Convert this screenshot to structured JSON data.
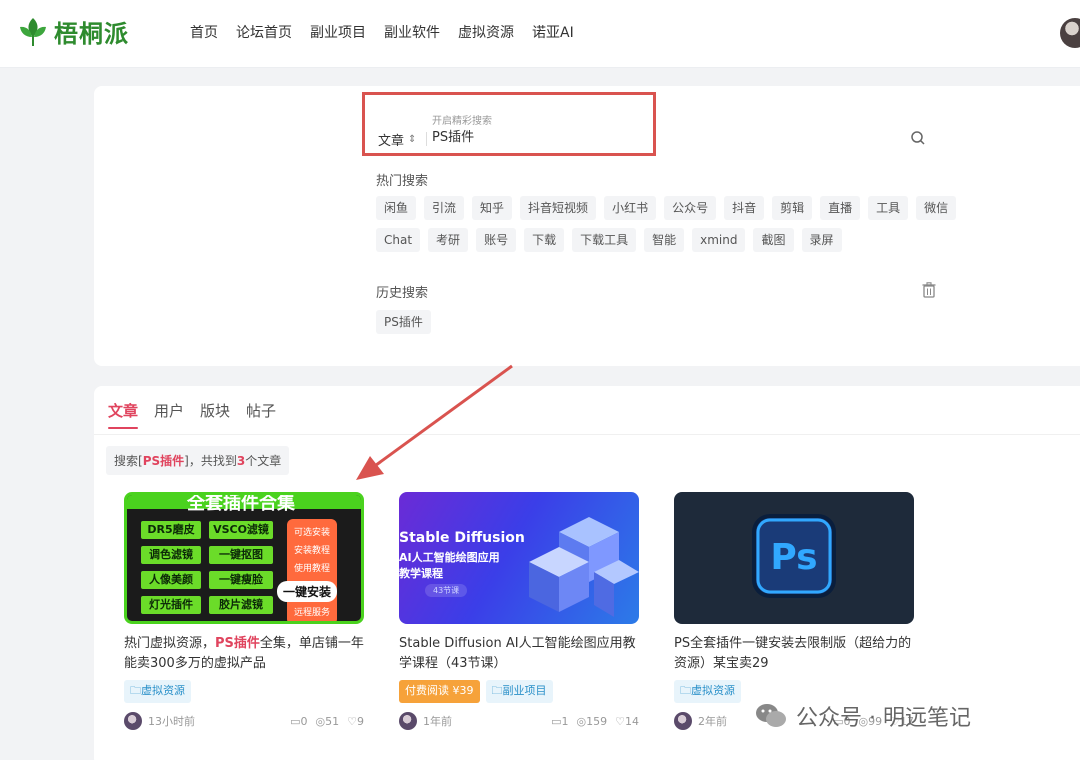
{
  "header": {
    "logo_text": "梧桐派",
    "nav": [
      "首页",
      "论坛首页",
      "副业项目",
      "副业软件",
      "虚拟资源",
      "诺亚AI"
    ]
  },
  "search": {
    "hint": "开启精彩搜索",
    "type": "文章",
    "value": "PS插件",
    "hot_label": "热门搜索",
    "hot_tags": [
      "闲鱼",
      "引流",
      "知乎",
      "抖音短视频",
      "小红书",
      "公众号",
      "抖音",
      "剪辑",
      "直播",
      "工具",
      "微信",
      "Chat",
      "考研",
      "账号",
      "下载",
      "下载工具",
      "智能",
      "xmind",
      "截图",
      "录屏"
    ],
    "history_label": "历史搜索",
    "history_tags": [
      "PS插件"
    ]
  },
  "results": {
    "tabs": [
      "文章",
      "用户",
      "版块",
      "帖子"
    ],
    "note_prefix": "搜索[",
    "note_keyword": "PS插件",
    "note_mid": "]，共找到",
    "note_count": "3",
    "note_suffix": "个文章",
    "cards": [
      {
        "title_prefix": "热门虚拟资源，",
        "title_hl": "PS插件",
        "title_suffix": "全集，单店铺一年能卖300多万的虚拟产品",
        "price": "",
        "category": "虚拟资源",
        "time": "13小时前",
        "comments": "0",
        "views": "51",
        "likes": "9",
        "thumb": {
          "top_text": "全套插件合集",
          "chips": [
            "DR5磨皮",
            "VSCO滤镜",
            "调色滤镜",
            "一键抠图",
            "人像美颜",
            "一键瘦脸",
            "灯光插件",
            "胶片滤镜"
          ],
          "side": [
            "可选安装",
            "安装教程",
            "使用教程",
            "远程服务"
          ],
          "badge": "一键安装"
        }
      },
      {
        "title_prefix": "Stable Diffusion AI人工智能绘图应用教学课程（43节课）",
        "title_hl": "",
        "title_suffix": "",
        "price": "付费阅读 ¥39",
        "category": "副业项目",
        "time": "1年前",
        "comments": "1",
        "views": "159",
        "likes": "14",
        "thumb": {
          "title": "Stable Diffusion",
          "sub1": "AI人工智能绘图应用",
          "sub2": "教学课程",
          "pill": "43节课"
        }
      },
      {
        "title_prefix": "PS全套插件一键安装去限制版（超给力的资源）某宝卖29",
        "title_hl": "",
        "title_suffix": "",
        "price": "",
        "category": "虚拟资源",
        "time": "2年前",
        "comments": "0",
        "views": "99",
        "likes": "17",
        "thumb": {
          "logo": "Ps"
        }
      }
    ]
  },
  "watermark": "公众号 · 明远笔记",
  "colors": {
    "accent": "#e0445e",
    "brand_green": "#2e8b2e",
    "highlight_box": "#d9534f"
  }
}
